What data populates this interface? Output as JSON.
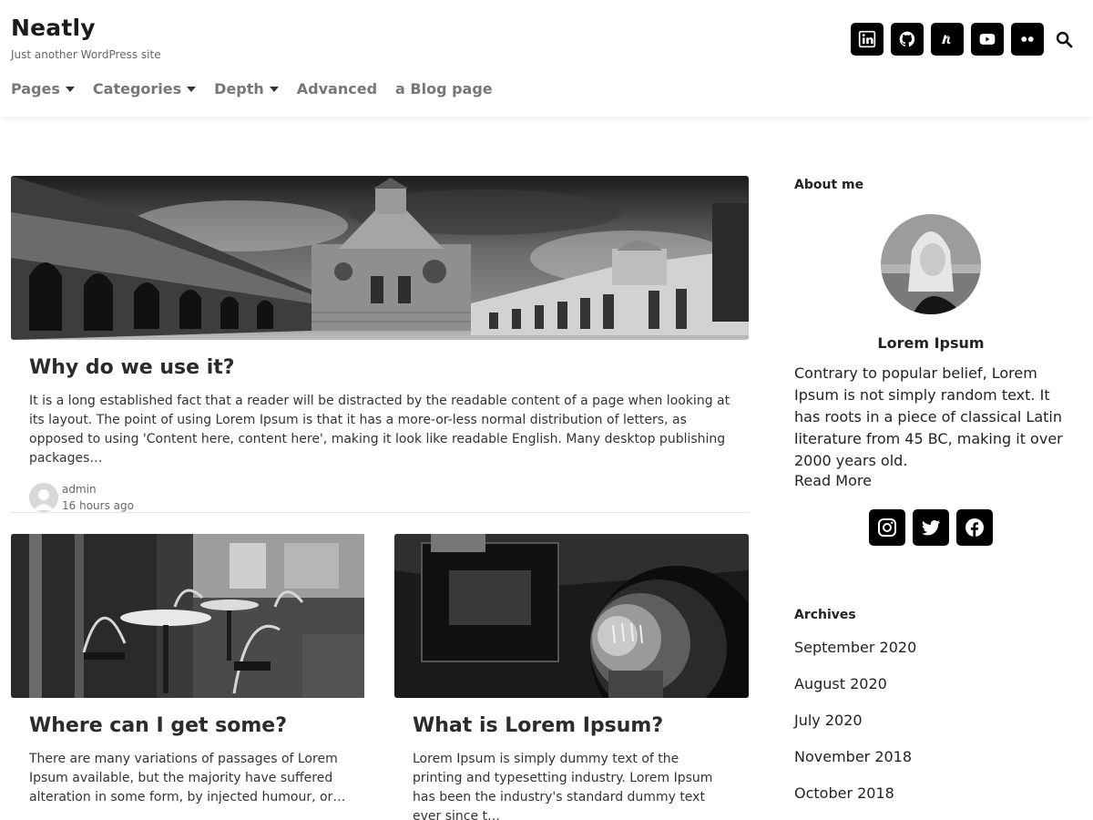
{
  "site": {
    "title": "Neatly",
    "tagline": "Just another WordPress site"
  },
  "nav": {
    "items": [
      {
        "label": "Pages",
        "has_dropdown": true
      },
      {
        "label": "Categories",
        "has_dropdown": true
      },
      {
        "label": "Depth",
        "has_dropdown": true
      },
      {
        "label": "Advanced",
        "has_dropdown": false
      },
      {
        "label": "a Blog page",
        "has_dropdown": false
      }
    ]
  },
  "header_social": [
    "linkedin-icon",
    "github-icon",
    "meetup-icon",
    "youtube-icon",
    "flickr-icon"
  ],
  "header_search_icon": "search-icon",
  "posts": [
    {
      "title": "Why do we use it?",
      "excerpt": "It is a long established fact that a reader will be distracted by the readable content of a page when looking at its layout. The point of using Lorem Ipsum is that it has a more-or-less normal distribution of letters, as opposed to using 'Content here, content here', making it look like readable English. Many desktop publishing packages…",
      "author": "admin",
      "date": "16 hours ago"
    },
    {
      "title": "Where can I get some?",
      "excerpt": "There are many variations of passages of Lorem Ipsum available, but the majority have suffered alteration in some form, by injected humour, or…"
    },
    {
      "title": "What is Lorem Ipsum?",
      "excerpt": "Lorem Ipsum is simply dummy text of the printing and typesetting industry. Lorem Ipsum has been the industry's standard dummy text ever since t…"
    }
  ],
  "sidebar": {
    "about": {
      "title": "About me",
      "name": "Lorem Ipsum",
      "text": "Contrary to popular belief, Lorem Ipsum is not simply random text. It has roots in a piece of classical Latin literature from 45 BC, making it over 2000 years old.",
      "read_more": "Read More",
      "social": [
        "instagram-icon",
        "twitter-icon",
        "facebook-icon"
      ]
    },
    "archives": {
      "title": "Archives",
      "items": [
        "September 2020",
        "August 2020",
        "July 2020",
        "November 2018",
        "October 2018"
      ]
    }
  },
  "colors": {
    "social_bg": "#000000",
    "nav_text": "#777777",
    "divider": "#e4e4e4"
  }
}
